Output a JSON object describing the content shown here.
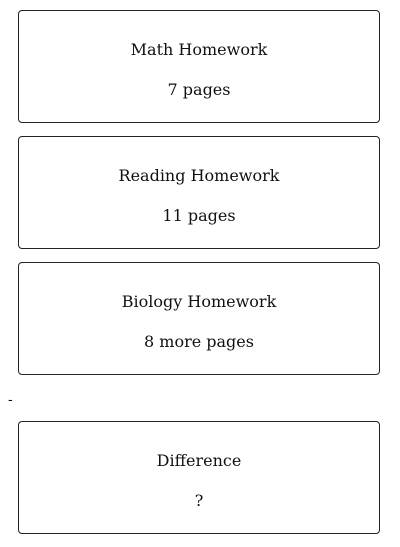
{
  "cards": [
    {
      "title": "Math Homework",
      "value": "7 pages"
    },
    {
      "title": "Reading Homework",
      "value": "11 pages"
    },
    {
      "title": "Biology Homework",
      "value": "8 more pages"
    }
  ],
  "operator": "-",
  "result_card": {
    "title": "Difference",
    "value": "?"
  }
}
